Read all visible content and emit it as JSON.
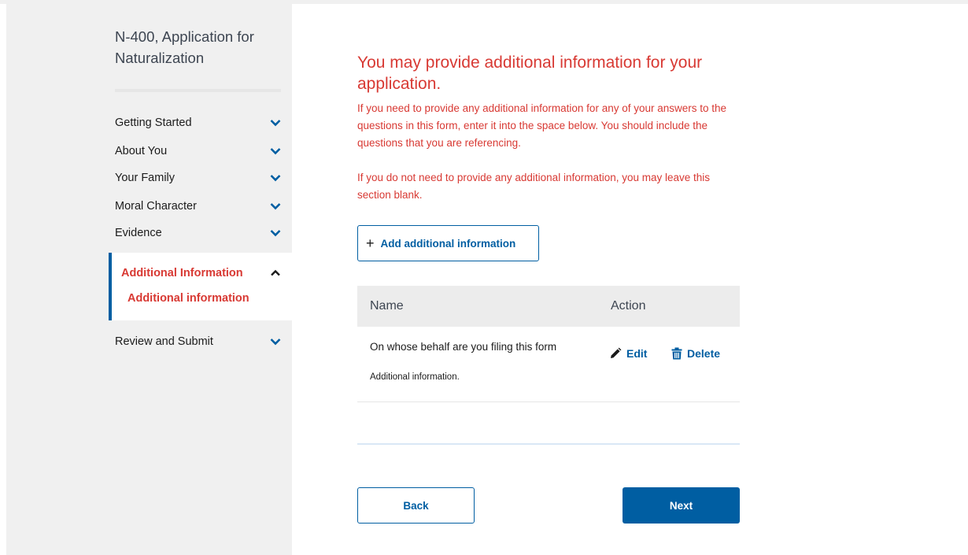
{
  "sidebar": {
    "app_title": "N-400, Application for Naturalization",
    "items": [
      {
        "label": "Getting Started"
      },
      {
        "label": "About You"
      },
      {
        "label": "Your Family"
      },
      {
        "label": "Moral Character"
      },
      {
        "label": "Evidence"
      }
    ],
    "active_section": {
      "label": "Additional Information",
      "sub_item": "Additional information"
    },
    "review_item": {
      "label": "Review and Submit"
    }
  },
  "main": {
    "heading": "You may provide additional information for your application.",
    "paragraph_1": "If you need to provide any additional information for any of your answers to the questions in this form, enter it into the space below. You should include the questions that you are referencing.",
    "paragraph_2": "If you do not need to provide any additional information, you may leave this section blank.",
    "add_button_icon": "+",
    "add_button_label": "Add additional information",
    "table": {
      "headers": {
        "name": "Name",
        "action": "Action"
      },
      "rows": [
        {
          "name": "On whose behalf are you filing this form",
          "description": "Additional information.",
          "edit_label": "Edit",
          "delete_label": "Delete"
        }
      ]
    },
    "back_label": "Back",
    "next_label": "Next"
  },
  "colors": {
    "accent": "#005ea2",
    "error_red": "#d83933",
    "sidebar_bg": "#f0f0f0"
  },
  "icons": [
    "chevron-down-icon",
    "chevron-up-icon",
    "plus-icon",
    "pencil-icon",
    "trash-icon"
  ]
}
